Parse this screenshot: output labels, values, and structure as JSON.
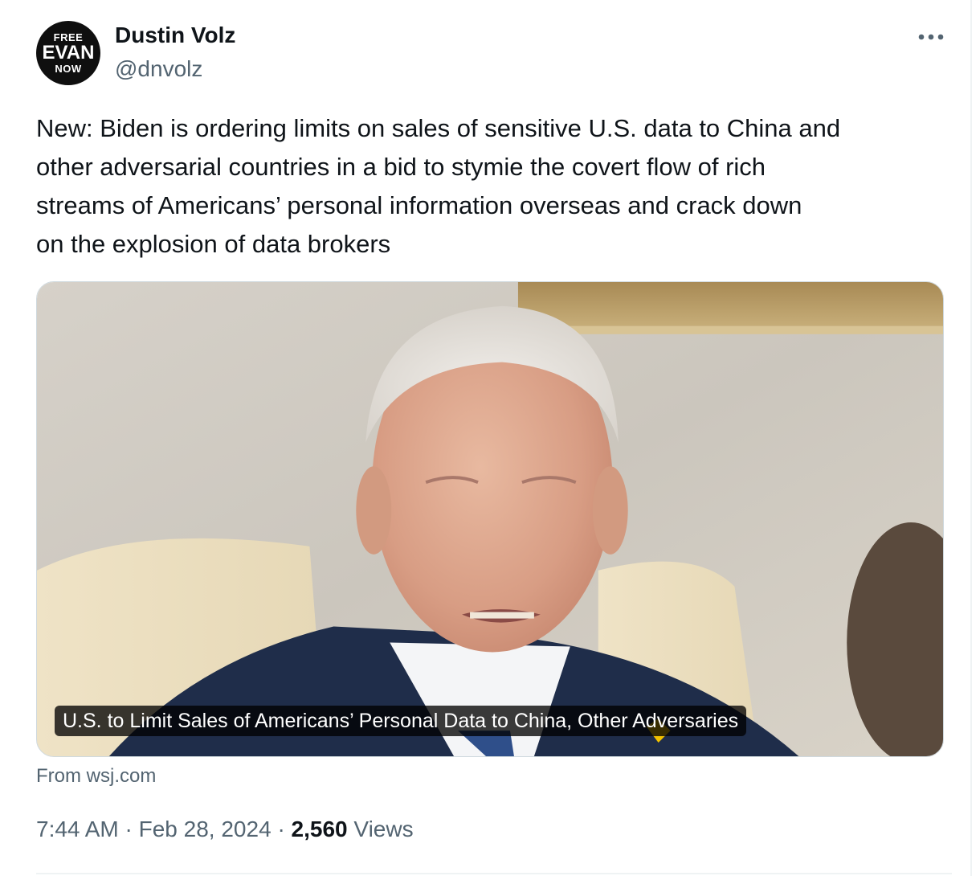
{
  "author": {
    "avatar_text": [
      "FREE",
      "EVAN",
      "NOW"
    ],
    "display_name": "Dustin Volz",
    "handle": "@dnvolz"
  },
  "more_icon": "more-horizontal-icon",
  "tweet": {
    "text": "New: Biden is ordering limits on sales of sensitive U.S. data to China and\nother adversarial countries in a bid to stymie the covert flow of rich\nstreams of Americans’ personal information overseas and crack down\non the explosion of data brokers"
  },
  "card": {
    "headline": "U.S. to Limit Sales of Americans’ Personal Data to China, Other Adversaries",
    "source": "From wsj.com"
  },
  "meta": {
    "time": "7:44 AM",
    "separator": "·",
    "date": "Feb 28, 2024",
    "views_count": "2,560",
    "views_label": "Views"
  },
  "colors": {
    "text_primary": "#0f1419",
    "text_secondary": "#536471",
    "border": "#cfd9de"
  }
}
